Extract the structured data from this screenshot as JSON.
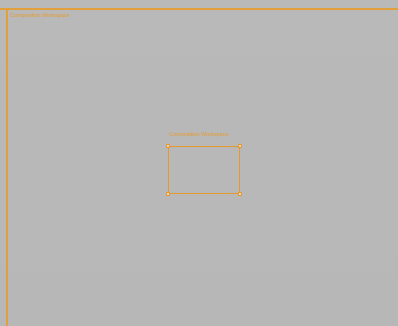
{
  "canvas": {
    "frame_label": "Composition Workspace",
    "selection_label": "Composition Workspace"
  },
  "colors": {
    "accent": "#e59a2f",
    "canvas_background": "#b8b8b8"
  },
  "icons": {
    "handles": [
      "resize-handle-top-left",
      "resize-handle-top-right",
      "resize-handle-bottom-left",
      "resize-handle-bottom-right"
    ]
  }
}
